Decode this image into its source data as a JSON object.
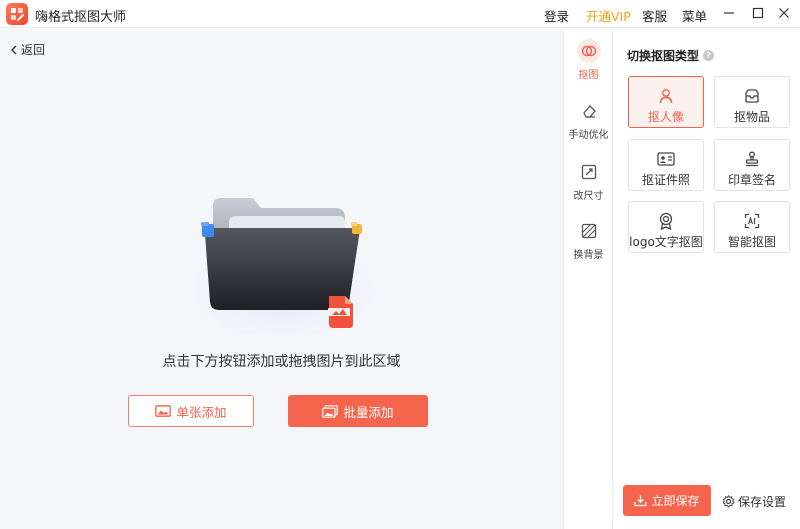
{
  "app": {
    "title": "嗨格式抠图大师"
  },
  "topbar": {
    "login": "登录",
    "vip": "开通VIP",
    "service": "客服",
    "menu": "菜单"
  },
  "main": {
    "back_label": "返回",
    "hint": "点击下方按钮添加或拖拽图片到此区域",
    "single_add": "单张添加",
    "batch_add": "批量添加"
  },
  "tools": [
    {
      "label": "抠图"
    },
    {
      "label": "手动优化"
    },
    {
      "label": "改尺寸"
    },
    {
      "label": "换背景"
    }
  ],
  "panel": {
    "title": "切换抠图类型",
    "types": [
      {
        "label": "抠人像"
      },
      {
        "label": "抠物品"
      },
      {
        "label": "抠证件照"
      },
      {
        "label": "印章签名"
      },
      {
        "label": "logo文字抠图"
      },
      {
        "label": "智能抠图"
      }
    ],
    "save_now": "立即保存",
    "save_settings": "保存设置"
  },
  "colors": {
    "accent": "#f5654d",
    "vip": "#f0a21a",
    "main_bg": "#f5f6fa"
  }
}
